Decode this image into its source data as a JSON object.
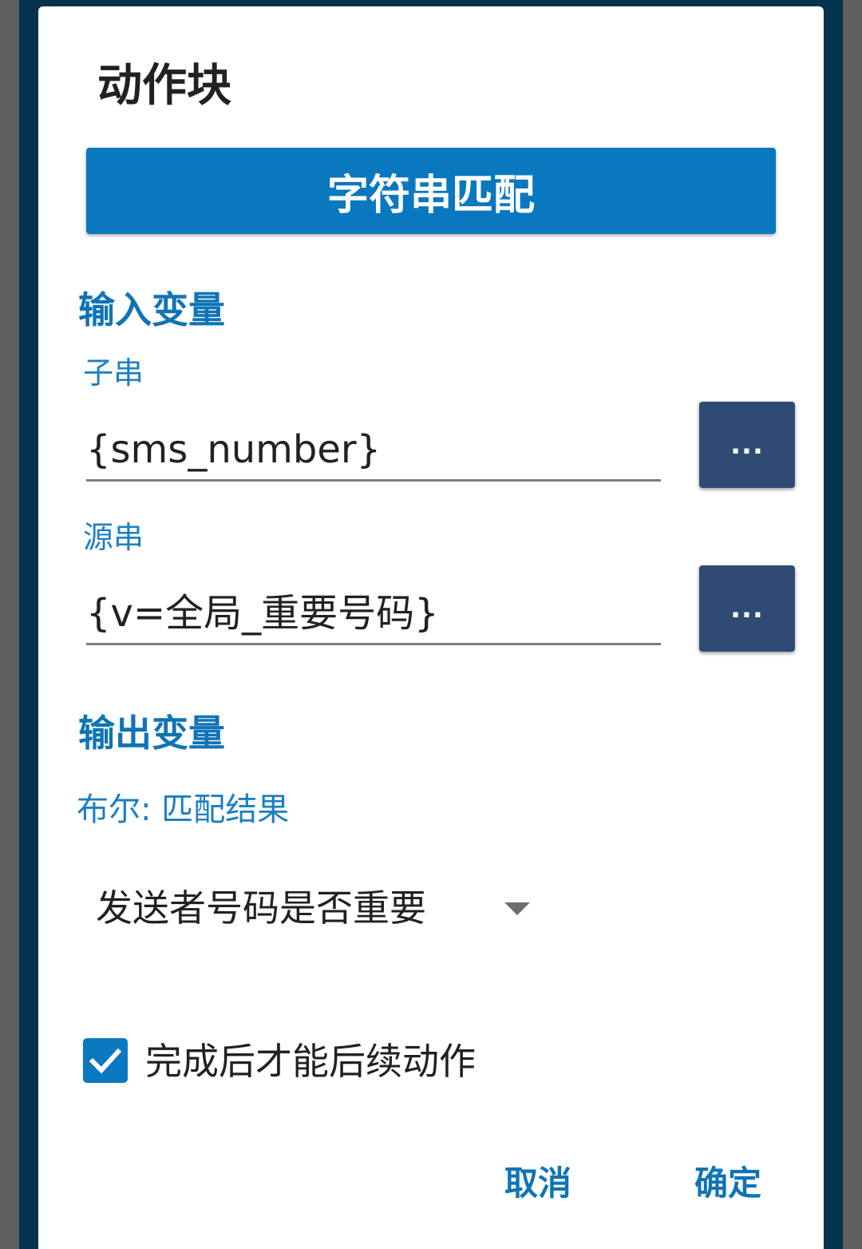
{
  "dialog": {
    "title": "动作块",
    "action_button_label": "字符串匹配"
  },
  "input_section": {
    "header": "输入变量",
    "fields": [
      {
        "label": "子串",
        "value": "{sms_number}",
        "more_label": "..."
      },
      {
        "label": "源串",
        "value": "{v=全局_重要号码}",
        "more_label": "..."
      }
    ]
  },
  "output_section": {
    "header": "输出变量",
    "bool_label": "布尔: 匹配结果",
    "dropdown_value": "发送者号码是否重要"
  },
  "wait_checkbox": {
    "label": "完成后才能后续动作",
    "checked": true
  },
  "footer": {
    "cancel_label": "取消",
    "ok_label": "确定"
  },
  "colors": {
    "accent": "#0a78bf",
    "more_button": "#2f4b73",
    "backdrop": "#05324d"
  }
}
